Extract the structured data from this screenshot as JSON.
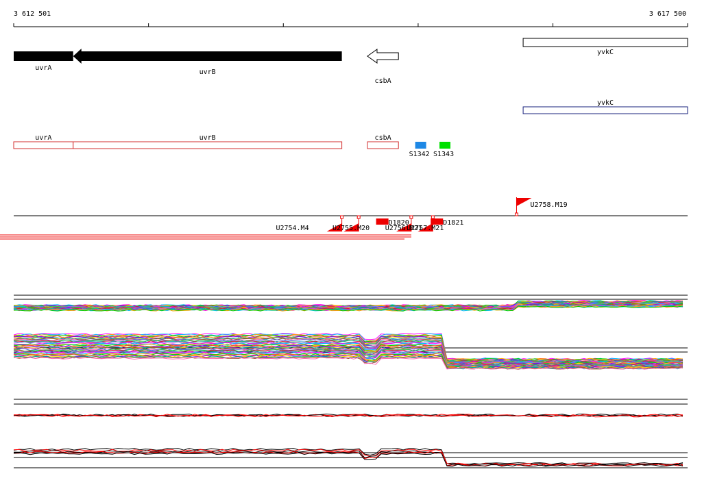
{
  "ruler": {
    "start_label": "3 612 501",
    "end_label": "3 617 500",
    "start": 3612501,
    "end": 3617500
  },
  "genes": [
    {
      "name": "uvrA",
      "start": 3612501,
      "end": 3612942,
      "strand": "-",
      "style": "filled"
    },
    {
      "name": "uvrB",
      "start": 3612942,
      "end": 3614935,
      "strand": "-",
      "style": "filled"
    },
    {
      "name": "csbA",
      "start": 3615125,
      "end": 3615355,
      "strand": "-",
      "style": "outline"
    },
    {
      "name": "yvkC",
      "start": 3616280,
      "end": 3617500,
      "strand": "+",
      "style": "box"
    }
  ],
  "transcripts": [
    {
      "name": "yvkC",
      "start": 3616280,
      "end": 3617500,
      "color": "#1a237e"
    }
  ],
  "features": [
    {
      "name": "uvrA",
      "start": 3612501,
      "end": 3612942,
      "color": "#d32f2f"
    },
    {
      "name": "uvrB",
      "start": 3612942,
      "end": 3614935,
      "color": "#d32f2f"
    },
    {
      "name": "csbA",
      "start": 3615125,
      "end": 3615355,
      "color": "#d32f2f"
    }
  ],
  "binding_sites": [
    {
      "name": "S1342",
      "position": 3615520,
      "color": "#1e88e5"
    },
    {
      "name": "S1343",
      "position": 3615700,
      "color": "#00e000"
    }
  ],
  "markers": [
    {
      "label": "U2758.M19",
      "position": 3616231,
      "strand": "+"
    },
    {
      "label": "U2754.M4",
      "position": 3614935,
      "strand": "-"
    },
    {
      "label": "U2755.M20",
      "position": 3615060,
      "strand": "-"
    },
    {
      "label": "U2756.M21",
      "position": 3615450,
      "strand": "-"
    },
    {
      "label": "U2757.M21",
      "position": 3615610,
      "strand": "-"
    }
  ],
  "terminators": [
    {
      "label": "D1820",
      "position": 3615230
    },
    {
      "label": "D1821",
      "position": 3615635
    }
  ],
  "colors": {
    "gene_fill": "#000000",
    "feature_outline": "#d32f2f",
    "marker": "#ee0000",
    "profile_reference": "#000000",
    "profile_highlight": "#ff0000"
  }
}
